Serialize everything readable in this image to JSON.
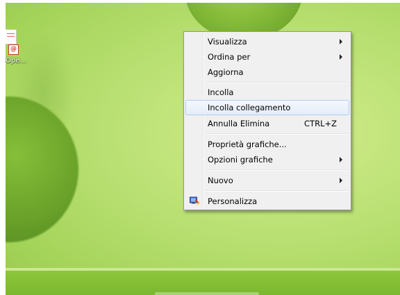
{
  "desktop": {
    "icon": {
      "label": "Ope...",
      "badge_glyph": "@"
    }
  },
  "context_menu": {
    "items": [
      {
        "label": "Visualizza",
        "submenu": true
      },
      {
        "label": "Ordina per",
        "submenu": true
      },
      {
        "label": "Aggiorna"
      },
      {
        "label": "Incolla"
      },
      {
        "label": "Incolla collegamento",
        "highlighted": true
      },
      {
        "label": "Annulla Elimina",
        "shortcut": "CTRL+Z"
      },
      {
        "label": "Proprietà grafiche..."
      },
      {
        "label": "Opzioni grafiche",
        "submenu": true
      },
      {
        "label": "Nuovo",
        "submenu": true
      },
      {
        "label": "Personalizza",
        "icon": "personalize-icon"
      }
    ]
  },
  "colors": {
    "highlight_border": "#aecdf0",
    "menu_background": "#f0f0f0",
    "taskbar": "#7cb82f"
  }
}
